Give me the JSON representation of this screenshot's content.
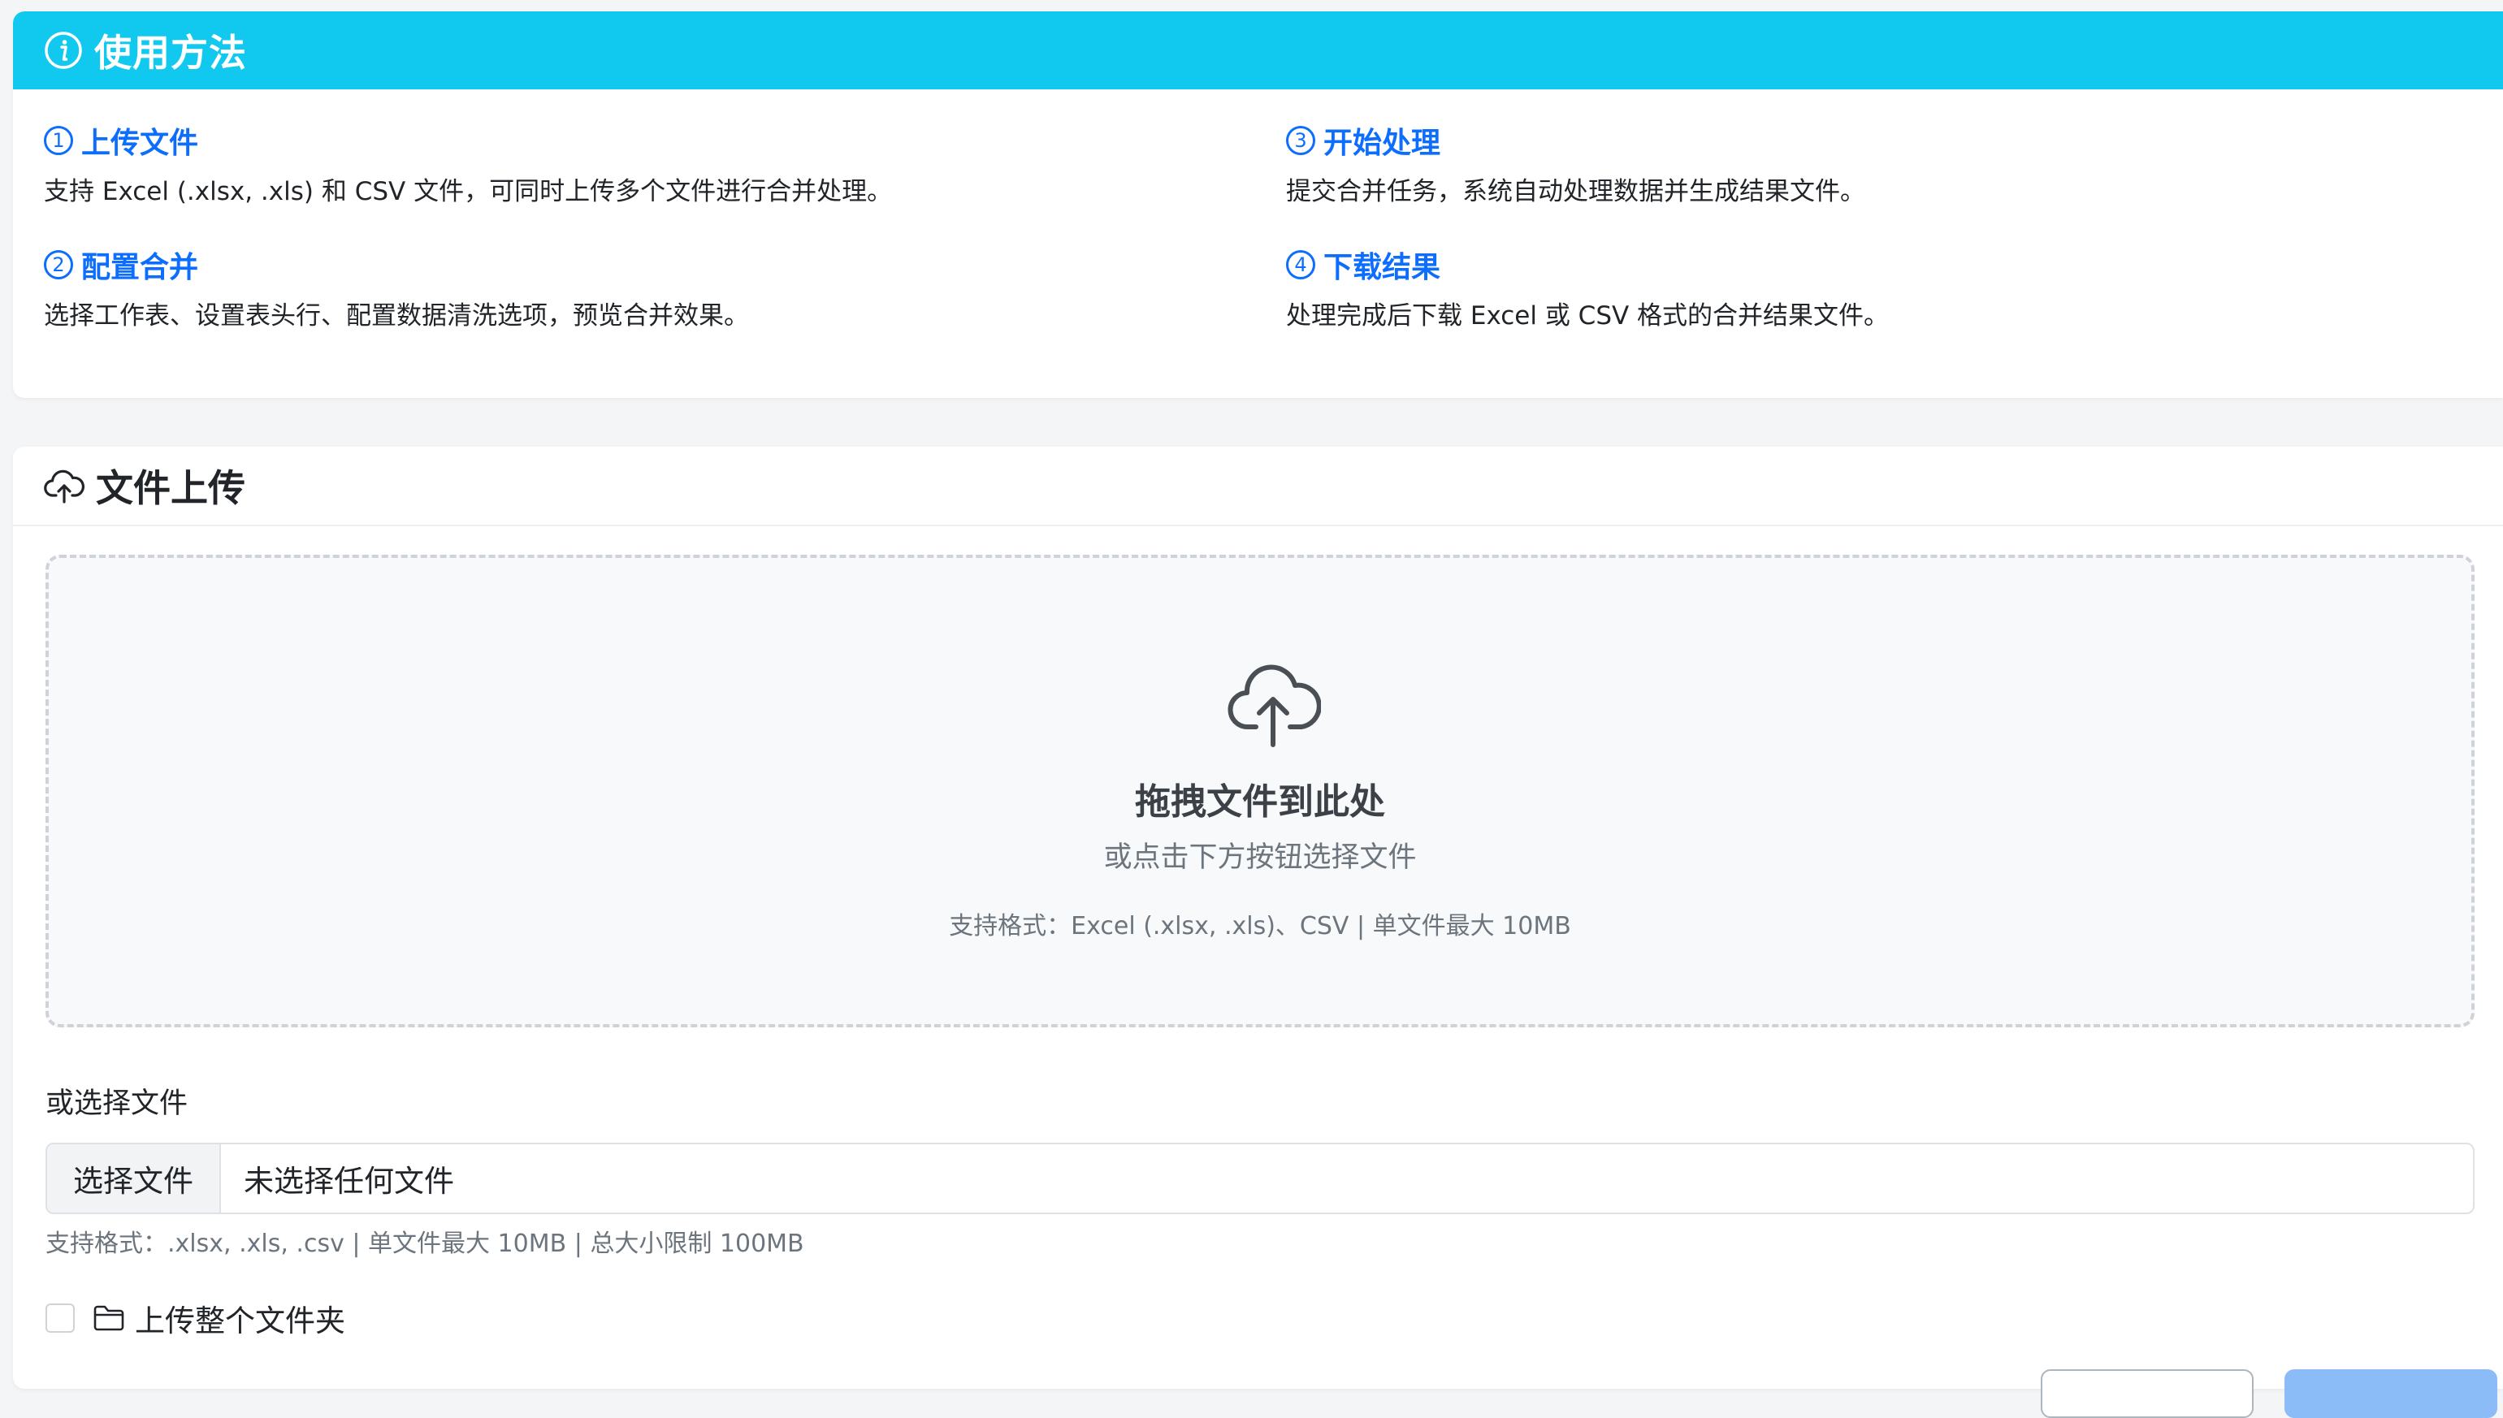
{
  "usage": {
    "title": "使用方法",
    "icon": "info-circle-icon",
    "steps": [
      {
        "num": "1",
        "title": "上传文件",
        "desc": "支持 Excel (.xlsx, .xls) 和 CSV 文件，可同时上传多个文件进行合并处理。"
      },
      {
        "num": "2",
        "title": "配置合并",
        "desc": "选择工作表、设置表头行、配置数据清洗选项，预览合并效果。"
      },
      {
        "num": "3",
        "title": "开始处理",
        "desc": "提交合并任务，系统自动处理数据并生成结果文件。"
      },
      {
        "num": "4",
        "title": "下载结果",
        "desc": "处理完成后下载 Excel 或 CSV 格式的合并结果文件。"
      }
    ]
  },
  "upload": {
    "title": "文件上传",
    "icon": "cloud-upload-icon",
    "dropzone": {
      "title": "拖拽文件到此处",
      "subtitle": "或点击下方按钮选择文件",
      "hint": "支持格式：Excel (.xlsx, .xls)、CSV | 单文件最大 10MB"
    },
    "or_label": "或选择文件",
    "choose_button": "选择文件",
    "file_status": "未选择任何文件",
    "format_hint": "支持格式：.xlsx, .xls, .csv | 单文件最大 10MB | 总大小限制 100MB",
    "folder_checkbox_label": "上传整个文件夹",
    "folder_checked": false
  },
  "colors": {
    "header_bg": "#11c9ef",
    "accent": "#0d6efd",
    "muted": "#6c757d"
  }
}
